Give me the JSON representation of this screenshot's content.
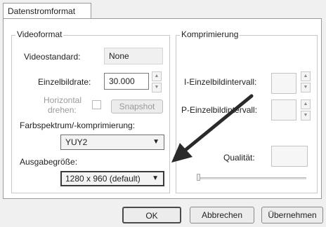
{
  "tab": {
    "label": "Datenstromformat"
  },
  "video": {
    "legend": "Videoformat",
    "standard_label": "Videostandard:",
    "standard_value": "None",
    "framerate_label": "Einzelbildrate:",
    "framerate_value": "30.000",
    "flip_label_line1": "Horizontal",
    "flip_label_line2": "drehen:",
    "snapshot_label": "Snapshot",
    "color_label": "Farbspektrum/-komprimierung:",
    "color_value": "YUY2",
    "output_label": "Ausgabegröße:",
    "output_value": "1280 x 960  (default)"
  },
  "compression": {
    "legend": "Komprimierung",
    "iframe_label": "I-Einzelbildintervall:",
    "pframe_label": "P-Einzelbildintervall:",
    "quality_label": "Qualität:"
  },
  "buttons": {
    "ok": "OK",
    "cancel": "Abbrechen",
    "apply": "Übernehmen"
  },
  "icons": {
    "spin": "spinner-arrows-icon",
    "dropdown": "chevron-down-icon",
    "arrow": "annotation-arrow-icon"
  }
}
